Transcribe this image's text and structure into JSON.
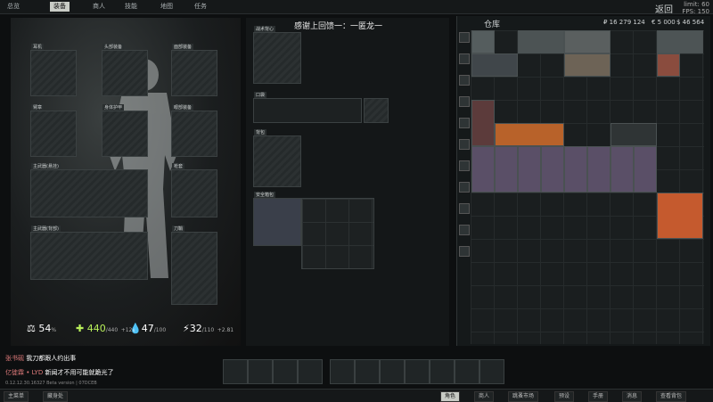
{
  "topbar": {
    "tabs": [
      "总览",
      "装备",
      "商人",
      "技能",
      "地图",
      "任务"
    ],
    "back_label": "返回",
    "limit": "limit: 60",
    "fps": "FPS: 150"
  },
  "loadout": {
    "slots": {
      "earpiece": "耳机",
      "headwear": "头部装备",
      "face_cover": "面部装备",
      "armband": "臂章",
      "body_armor": "身体护甲",
      "eyewear": "眼部装备",
      "primary1": "主武器(悬挂)",
      "holster": "枪套",
      "primary2": "主武器(背部)",
      "scabbard": "刀鞘"
    },
    "stats": {
      "weight": "54",
      "weight_unit": "%",
      "health": "440",
      "health_max": "/440",
      "health_regen": "+12/7",
      "hydration": "47",
      "hydration_max": "/100",
      "energy": "32",
      "energy_max": "/110",
      "energy_regen": "+2.81"
    }
  },
  "center": {
    "title": "感谢上回馈一：一匿龙一",
    "tactical_rig": "战术背心",
    "pockets": "口袋",
    "backpack": "背包",
    "secure_container": "安全箱包"
  },
  "stash": {
    "title": "仓库",
    "rubles": "₽ 16 279 124",
    "euros": "€ 5 000",
    "dollars": "$ 46 564"
  },
  "chat": {
    "lines": [
      {
        "name": "张书砚",
        "text": "我刀都跟人约出事"
      },
      {
        "name": "亿徙霖 • LYD",
        "text": "新闻才不用可能就跪光了"
      }
    ],
    "version": "0.12.12.30.16327 Beta version | 07DCEB"
  },
  "bottombar": {
    "main_menu": "主菜单",
    "hideout": "藏身处",
    "character": "角色",
    "traders": "商人",
    "flea": "跳蚤市场",
    "presets": "预设",
    "handbook": "手册",
    "messages": "消息",
    "inspect": "查看背包"
  },
  "colors": {
    "accent": "#c9ccc6",
    "background": "#0d0f10"
  }
}
